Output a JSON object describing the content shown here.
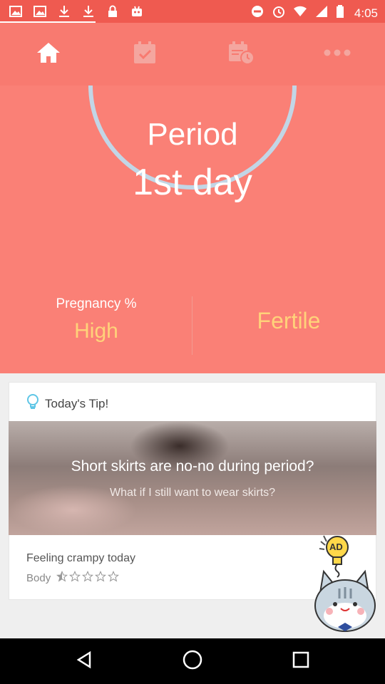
{
  "status_bar": {
    "time": "4:05"
  },
  "nav": {
    "tabs": [
      {
        "icon": "home-icon"
      },
      {
        "icon": "calendar-check-icon"
      },
      {
        "icon": "calendar-clock-icon"
      },
      {
        "icon": "more-icon"
      }
    ]
  },
  "cycle": {
    "title": "Period",
    "day": "1st day"
  },
  "pregnancy": {
    "label": "Pregnancy %",
    "value": "High"
  },
  "fertility": {
    "label": "Fertile"
  },
  "tip": {
    "header": "Today's Tip!",
    "title": "Short skirts are no-no during period?",
    "subtitle": "What if I still want to wear skirts?"
  },
  "feeling": {
    "text": "Feeling crampy today",
    "body_label": "Body",
    "rating": 0.5,
    "max": 5
  },
  "ad": {
    "label": "AD"
  },
  "colors": {
    "accent": "#fa8076",
    "status_bar": "#ef5a50",
    "nav_bar": "#f87a70",
    "highlight": "#ffd27a",
    "ring": "#c2d6e6"
  }
}
